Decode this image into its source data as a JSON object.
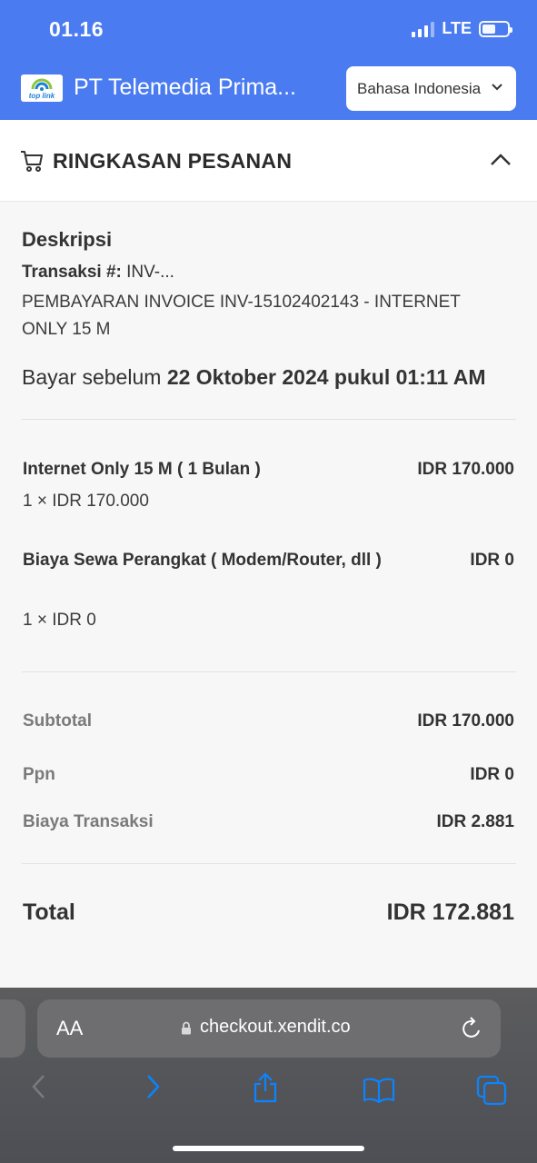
{
  "status_bar": {
    "time": "01.16",
    "network": "LTE"
  },
  "header": {
    "logo_text": "top link",
    "company": "PT Telemedia Prima...",
    "language": "Bahasa Indonesia"
  },
  "summary": {
    "title": "RINGKASAN PESANAN"
  },
  "description": {
    "heading": "Deskripsi",
    "transaction_label": "Transaksi #:",
    "transaction_value": " INV-...",
    "invoice_text": "PEMBAYARAN INVOICE INV-15102402143 - INTERNET ONLY 15 M",
    "due_prefix": "Bayar sebelum ",
    "due_date": "22 Oktober 2024 pukul 01:11 AM"
  },
  "items": [
    {
      "name": "Internet Only 15 M ( 1 Bulan )",
      "qty": "1 × IDR 170.000",
      "price": "IDR 170.000"
    },
    {
      "name": "Biaya Sewa Perangkat ( Modem/Router, dll )",
      "qty": "1 × IDR 0",
      "price": "IDR 0"
    }
  ],
  "totals": {
    "subtotal_label": "Subtotal",
    "subtotal_value": "IDR 170.000",
    "ppn_label": "Ppn",
    "ppn_value": "IDR 0",
    "fee_label": "Biaya Transaksi",
    "fee_value": "IDR 2.881",
    "total_label": "Total",
    "total_value": "IDR 172.881"
  },
  "browser": {
    "aa_label": "AA",
    "url": "checkout.xendit.co"
  },
  "colors": {
    "header_blue": "#4a7bf0",
    "ios_blue": "#0a84ff"
  }
}
